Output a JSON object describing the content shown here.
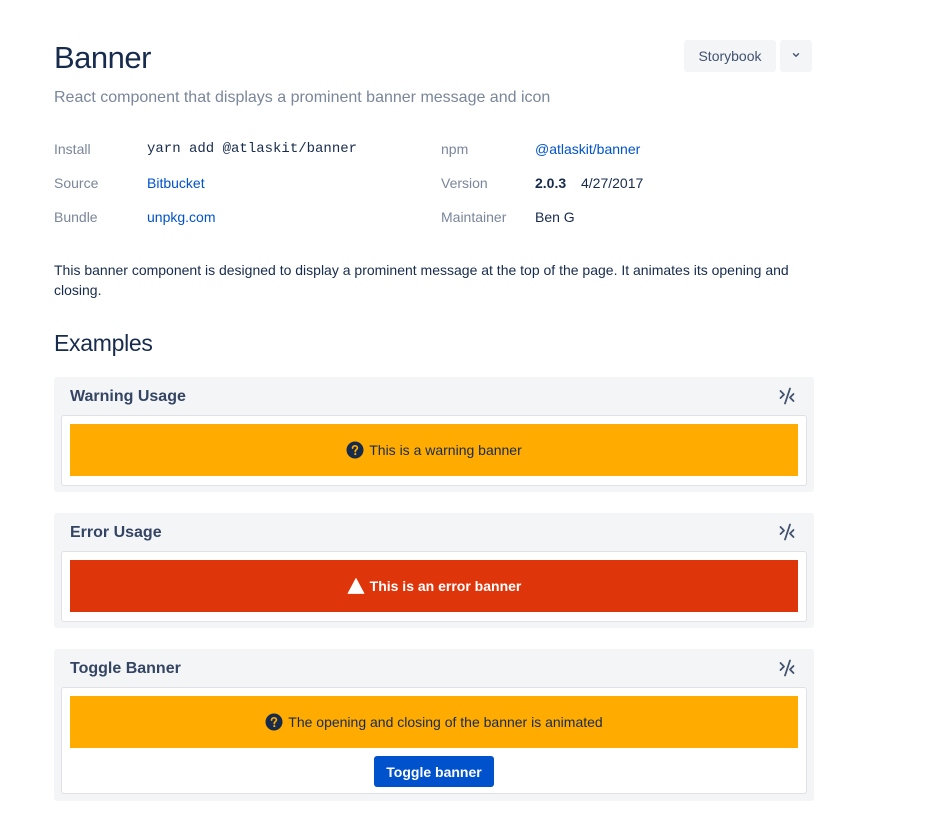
{
  "header": {
    "title": "Banner",
    "subtitle": "React component that displays a prominent banner message and icon",
    "storybook_label": "Storybook"
  },
  "meta": {
    "install": {
      "label": "Install",
      "value": "yarn add @atlaskit/banner"
    },
    "source": {
      "label": "Source",
      "value": "Bitbucket"
    },
    "bundle": {
      "label": "Bundle",
      "value": "unpkg.com"
    },
    "npm": {
      "label": "npm",
      "value": "@atlaskit/banner"
    },
    "version": {
      "label": "Version",
      "value": "2.0.3",
      "date": "4/27/2017"
    },
    "maintainer": {
      "label": "Maintainer",
      "value": "Ben G"
    }
  },
  "description": "This banner component is designed to display a prominent message at the top of the page. It animates its opening and closing.",
  "examples": {
    "heading": "Examples",
    "items": [
      {
        "title": "Warning Usage",
        "banner_text": "This is a warning banner",
        "appearance": "warning"
      },
      {
        "title": "Error Usage",
        "banner_text": "This is an error banner",
        "appearance": "error"
      },
      {
        "title": "Toggle Banner",
        "banner_text": "The opening and closing of the banner is animated",
        "appearance": "warning",
        "button_label": "Toggle banner"
      }
    ]
  },
  "colors": {
    "warning": "#FFAB00",
    "error": "#DE350B",
    "primary": "#0052CC",
    "link": "#0052CC"
  },
  "icons": {
    "storybook_menu": "chevron-down-icon",
    "code_toggle": "code-toggle-icon",
    "warning_banner": "question-circle-icon",
    "error_banner": "warning-triangle-icon"
  }
}
